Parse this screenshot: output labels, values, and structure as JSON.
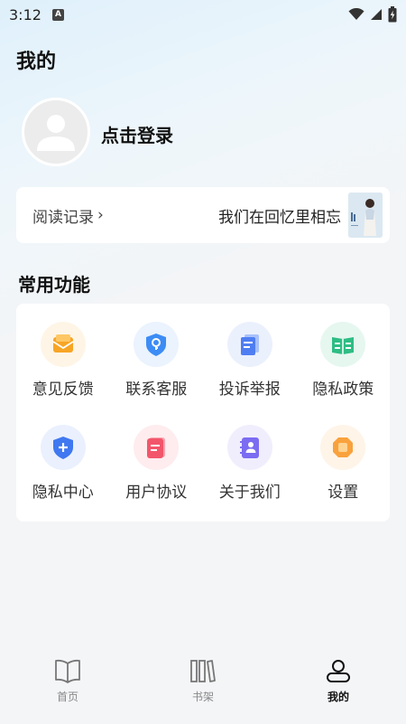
{
  "status_bar": {
    "time": "3:12",
    "notif_letter": "A"
  },
  "page_title": "我的",
  "profile": {
    "login_label": "点击登录"
  },
  "reading": {
    "label": "阅读记录",
    "chevron": "›",
    "last_book_title": "我们在回忆里相忘"
  },
  "functions": {
    "title": "常用功能",
    "items": [
      {
        "label": "意见反馈",
        "icon": "feedback-icon",
        "color": "#f7a526",
        "bg": "#fef5e6"
      },
      {
        "label": "联系客服",
        "icon": "customer-service-icon",
        "color": "#3d8cf5",
        "bg": "#eaf3fe"
      },
      {
        "label": "投诉举报",
        "icon": "complaint-report-icon",
        "color": "#4f7ef2",
        "bg": "#ebf0fd"
      },
      {
        "label": "隐私政策",
        "icon": "privacy-policy-icon",
        "color": "#2ebd84",
        "bg": "#e6f7f0"
      },
      {
        "label": "隐私中心",
        "icon": "privacy-center-icon",
        "color": "#3f78f0",
        "bg": "#eaf0fd"
      },
      {
        "label": "用户协议",
        "icon": "user-agreement-icon",
        "color": "#f2566b",
        "bg": "#feecee"
      },
      {
        "label": "关于我们",
        "icon": "about-us-icon",
        "color": "#7b6cf2",
        "bg": "#f0eefd"
      },
      {
        "label": "设置",
        "icon": "settings-icon",
        "color": "#f9a23d",
        "bg": "#fef4e8"
      }
    ]
  },
  "bottom_nav": {
    "items": [
      {
        "label": "首页",
        "icon": "book-open-icon",
        "active": false
      },
      {
        "label": "书架",
        "icon": "bookshelf-icon",
        "active": false
      },
      {
        "label": "我的",
        "icon": "profile-icon",
        "active": true
      }
    ]
  }
}
